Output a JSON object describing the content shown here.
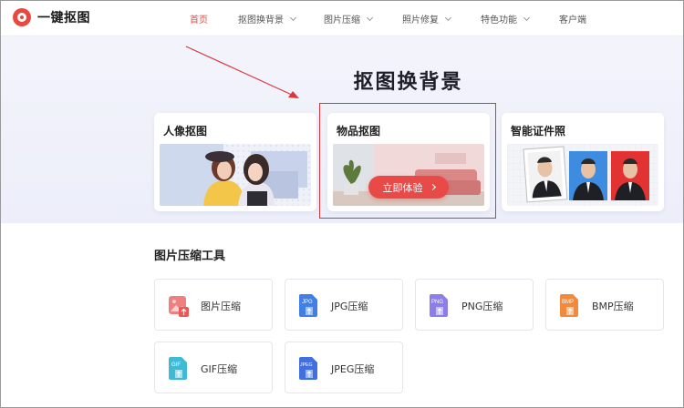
{
  "header": {
    "logo_text": "一键抠图",
    "nav": [
      {
        "label": "首页",
        "active": true
      },
      {
        "label": "抠图换背景",
        "dropdown": true
      },
      {
        "label": "图片压缩",
        "dropdown": true
      },
      {
        "label": "照片修复",
        "dropdown": true
      },
      {
        "label": "特色功能",
        "dropdown": true
      },
      {
        "label": "客户端",
        "dropdown": false
      }
    ]
  },
  "hero": {
    "title": "抠图换背景",
    "cards": [
      {
        "title": "人像抠图"
      },
      {
        "title": "物品抠图",
        "cta": "立即体验"
      },
      {
        "title": "智能证件照"
      }
    ]
  },
  "tools": {
    "section_title": "图片压缩工具",
    "items": [
      {
        "label": "图片压缩",
        "icon": "image-compress-icon",
        "badge": ""
      },
      {
        "label": "JPG压缩",
        "icon": "jpg-file-icon",
        "badge": "JPG"
      },
      {
        "label": "PNG压缩",
        "icon": "png-file-icon",
        "badge": "PNG"
      },
      {
        "label": "BMP压缩",
        "icon": "bmp-file-icon",
        "badge": "BMP"
      },
      {
        "label": "GIF压缩",
        "icon": "gif-file-icon",
        "badge": "GIF"
      },
      {
        "label": "JPEG压缩",
        "icon": "jpeg-file-icon",
        "badge": "JPEG"
      }
    ]
  },
  "colors": {
    "accent": "#e8483f",
    "jpg": "#3f7fe6",
    "png": "#8b7ee8",
    "bmp": "#f28a3b",
    "gif": "#3fb9d6",
    "jpeg": "#3f6fe0"
  }
}
